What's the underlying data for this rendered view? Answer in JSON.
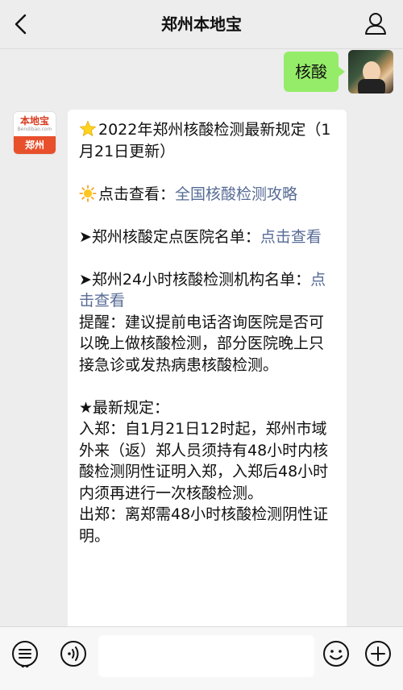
{
  "header": {
    "title": "郑州本地宝"
  },
  "outgoing": {
    "text": "核酸"
  },
  "incoming": {
    "avatar_logo_cn": "本地宝",
    "avatar_logo_en": "Bendibao.com",
    "avatar_city": "郑州",
    "line1": "2022年郑州核酸检测最新规定（1月21日更新）",
    "line2_prefix": "点击查看：",
    "line2_link": "全国核酸检测攻略",
    "line3_prefix": "➤郑州核酸定点医院名单：",
    "line3_link": "点击查看",
    "line4_prefix": "➤郑州24小时核酸检测机构名单：",
    "line4_link": "点击查看",
    "line5": "提醒：建议提前电话咨询医院是否可以晚上做核酸检测，部分医院晚上只接急诊或发热病患核酸检测。",
    "line6": "★最新规定：",
    "line7": "入郑：自1月21日12时起，郑州市域外来（返）郑人员须持有48小时内核酸检测阴性证明入郑，入郑后48小时内须再进行一次核酸检测。",
    "line8": "出郑：离郑需48小时核酸检测阴性证明。"
  },
  "colors": {
    "out_bubble": "#95ec69",
    "link": "#576b95",
    "brand": "#e8502c"
  },
  "icons": {
    "back": "chevron-left-icon",
    "profile": "person-icon",
    "voice": "voice-icon",
    "emoji": "emoji-icon",
    "more": "plus-icon",
    "menu": "menu-list-icon"
  }
}
